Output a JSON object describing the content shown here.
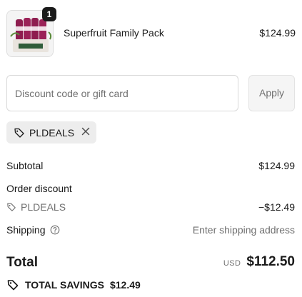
{
  "product": {
    "name": "Superfruit Family Pack",
    "price": "$124.99",
    "quantity": "1",
    "image_alt": "Superfruit Family Pack bottles"
  },
  "discount": {
    "placeholder": "Discount code or gift card",
    "value": "",
    "apply_label": "Apply",
    "applied_code": "PLDEALS"
  },
  "summary": {
    "subtotal_label": "Subtotal",
    "subtotal_value": "$124.99",
    "order_discount_label": "Order discount",
    "discount_code": "PLDEALS",
    "discount_value": "−$12.49",
    "shipping_label": "Shipping",
    "shipping_value": "Enter shipping address",
    "total_label": "Total",
    "currency": "USD",
    "total_value": "$112.50",
    "savings_label": "TOTAL SAVINGS",
    "savings_value": "$12.49"
  },
  "icons": {
    "tag": "tag-icon",
    "close": "close-icon",
    "help": "help-circle-icon"
  },
  "colors": {
    "text": "#1a1a1a",
    "muted": "#707070",
    "chip_bg": "#ededed",
    "badge_bg": "#1a1a1a"
  }
}
